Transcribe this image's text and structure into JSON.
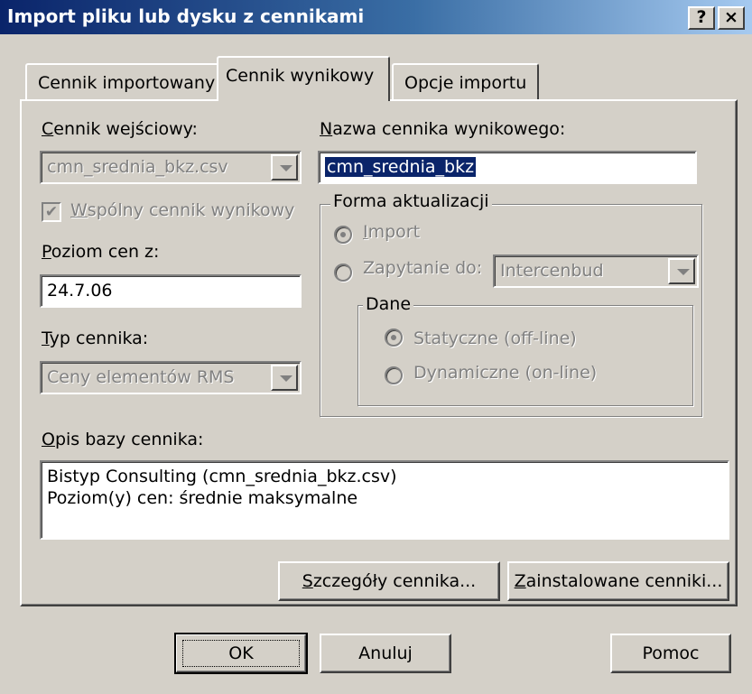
{
  "window": {
    "title": "Import pliku lub dysku z cennikami",
    "help_btn": "?",
    "close_btn": "×"
  },
  "tabs": [
    {
      "label": "Cennik importowany",
      "active": false
    },
    {
      "label": "Cennik wynikowy",
      "active": true
    },
    {
      "label": "Opcje importu",
      "active": false
    }
  ],
  "left": {
    "input_label_first": "C",
    "input_label_rest": "ennik wejściowy:",
    "input_value": "cmn_srednia_bkz.csv",
    "common_checkbox_first": "W",
    "common_checkbox_rest": "spólny cennik wynikowy",
    "common_checked": true,
    "price_level_label_first": "P",
    "price_level_label_rest": "oziom cen z:",
    "price_level_value": "24.7.06",
    "type_label_first": "T",
    "type_label_rest": "yp cennika:",
    "type_value": "Ceny elementów RMS"
  },
  "right": {
    "name_label_first": "N",
    "name_label_rest": "azwa cennika wynikowego:",
    "name_value": "cmn_srednia_bkz",
    "update_group": "Forma aktualizacji",
    "radio_import_first": "I",
    "radio_import_rest": "mport",
    "radio_query": "Zapytanie do:",
    "query_value": "Intercenbud",
    "data_group": "Dane",
    "radio_static": "Statyczne (off-line)",
    "radio_dynamic": "Dynamiczne (on-line)"
  },
  "description": {
    "label_first": "O",
    "label_rest": "pis bazy cennika:",
    "line1": "Bistyp Consulting (cmn_srednia_bkz.csv)",
    "line2": "Poziom(y) cen: średnie maksymalne"
  },
  "panel_buttons": {
    "details_first": "S",
    "details_rest": "zczegóły cennika...",
    "installed_first": "Z",
    "installed_rest": "ainstalowane cenniki..."
  },
  "footer": {
    "ok": "OK",
    "cancel": "Anuluj",
    "help": "Pomoc"
  }
}
